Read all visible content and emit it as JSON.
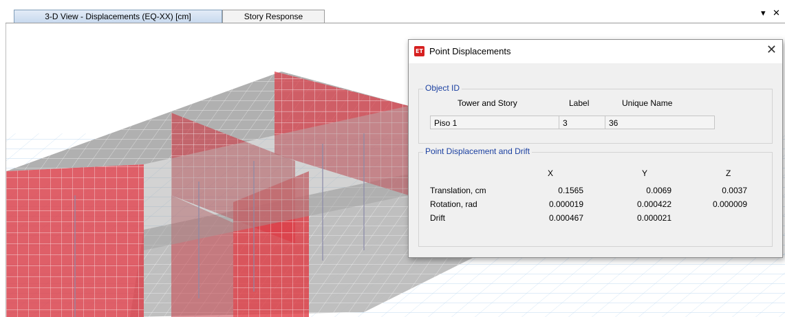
{
  "tabs": [
    {
      "label": "3-D View  - Displacements (EQ-XX)  [cm]",
      "active": true
    },
    {
      "label": "Story Response",
      "active": false
    }
  ],
  "pane_controls": {
    "dropdown": "▾",
    "close": "✕"
  },
  "dialog": {
    "icon_text": "ET",
    "title": "Point Displacements",
    "close": "✕",
    "object_id": {
      "group_label": "Object ID",
      "headers": {
        "tower_story": "Tower and Story",
        "label": "Label",
        "unique_name": "Unique Name"
      },
      "values": {
        "tower_story": "Piso 1",
        "label": "3",
        "unique_name": "36"
      }
    },
    "displacement": {
      "group_label": "Point Displacement and Drift",
      "columns": [
        "X",
        "Y",
        "Z"
      ],
      "rows": [
        {
          "label": "Translation, cm",
          "x": "0.1565",
          "y": "0.0069",
          "z": "0.0037"
        },
        {
          "label": "Rotation, rad",
          "x": "0.000019",
          "y": "0.000422",
          "z": "0.000009"
        },
        {
          "label": "Drift",
          "x": "0.000467",
          "y": "0.000021",
          "z": ""
        }
      ]
    }
  },
  "colors": {
    "wall_red": "#d9434d",
    "slab_gray": "#a8a8a8",
    "grid_blue": "#9cc4e6",
    "accent": "#1a3fa0"
  }
}
